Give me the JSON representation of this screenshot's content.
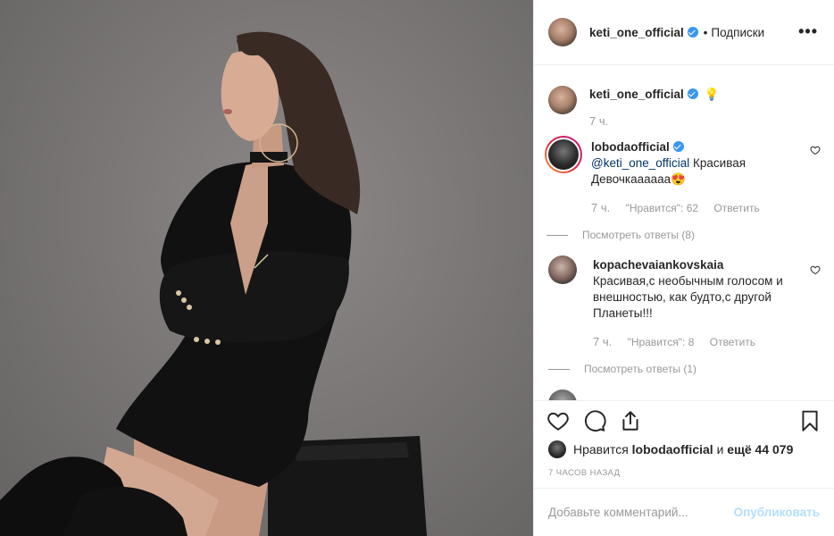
{
  "post": {
    "author": "keti_one_official",
    "follow_label": "Подписки",
    "more_label": "•••",
    "caption_emoji": "💡",
    "caption_time": "7 ч."
  },
  "comments": [
    {
      "username": "lobodaofficial",
      "verified": true,
      "mention": "@keti_one_official",
      "text": " Красивая Девочкаааааа😍",
      "time": "7 ч.",
      "likes": "\"Нравится\": 62",
      "reply_label": "Ответить",
      "view_replies": "Посмотреть ответы (8)"
    },
    {
      "username": "kopachevaiankovskaia",
      "verified": false,
      "text": "Красивая,с необычным голосом и внешностью, как будто,с другой Планеты!!!",
      "time": "7 ч.",
      "likes": "\"Нравится\": 8",
      "reply_label": "Ответить",
      "view_replies": "Посмотреть ответы (1)"
    }
  ],
  "likes": {
    "prefix": "Нравится",
    "user": "lobodaofficial",
    "connector": "и",
    "others": "ещё 44 079"
  },
  "timestamp": "7 ЧАСОВ НАЗАД",
  "add_comment": {
    "placeholder": "Добавьте комментарий...",
    "publish_label": "Опубликовать"
  },
  "colors": {
    "verified": "#3897f0",
    "mention": "#003569",
    "publish_disabled": "#b2dffc",
    "muted": "#999999"
  },
  "icons": [
    "heart-icon",
    "comment-icon",
    "share-icon",
    "bookmark-icon",
    "verified-badge-icon",
    "more-options-icon"
  ]
}
